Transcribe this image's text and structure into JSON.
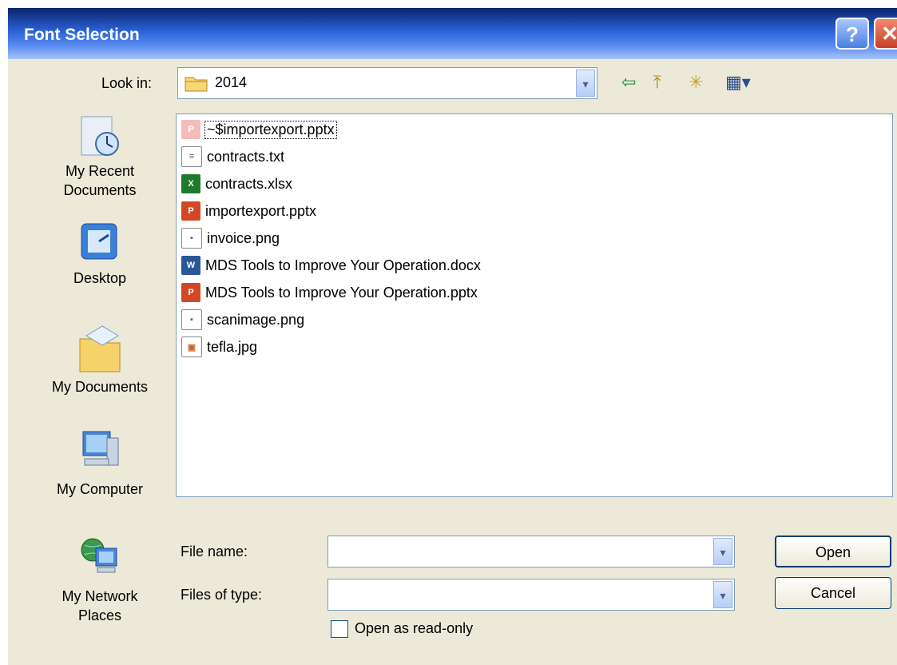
{
  "window": {
    "title": "Font Selection",
    "help_label": "?",
    "close_label": "✕"
  },
  "look_in": {
    "label": "Look in:",
    "value": "2014"
  },
  "toolbar": {
    "back_icon": "⇦",
    "up_icon": "⤒",
    "new_folder_icon": "✳",
    "views_icon": "▦▾"
  },
  "places": [
    {
      "label_line1": "My Recent",
      "label_line2": "Documents",
      "icon": "clock"
    },
    {
      "label_line1": "Desktop",
      "label_line2": "",
      "icon": "desktop"
    },
    {
      "label_line1": "My Documents",
      "label_line2": "",
      "icon": "folder"
    },
    {
      "label_line1": "My Computer",
      "label_line2": "",
      "icon": "computer"
    },
    {
      "label_line1": "My Network",
      "label_line2": "Places",
      "icon": "globe"
    }
  ],
  "files": [
    {
      "name": "~$importexport.pptx",
      "type": "pptx-temp",
      "color": "#f2a0a0",
      "glyph": "P"
    },
    {
      "name": "contracts.txt",
      "type": "txt",
      "color": "#ffffff",
      "glyph": "≡"
    },
    {
      "name": "contracts.xlsx",
      "type": "xlsx",
      "color": "#1e7a2e",
      "glyph": "X"
    },
    {
      "name": "importexport.pptx",
      "type": "pptx",
      "color": "#d24726",
      "glyph": "P"
    },
    {
      "name": "invoice.png",
      "type": "png",
      "color": "#3a73c8",
      "glyph": "▪"
    },
    {
      "name": "MDS Tools to Improve Your Operation.docx",
      "type": "docx",
      "color": "#2b579a",
      "glyph": "W"
    },
    {
      "name": "MDS Tools to Improve Your Operation.pptx",
      "type": "pptx",
      "color": "#d24726",
      "glyph": "P"
    },
    {
      "name": "scanimage.png",
      "type": "png",
      "color": "#3a73c8",
      "glyph": "▪"
    },
    {
      "name": "tefla.jpg",
      "type": "jpg",
      "color": "#c8682a",
      "glyph": "▣"
    }
  ],
  "form": {
    "file_name_label": "File name:",
    "file_name_value": "",
    "files_of_type_label": "Files of type:",
    "files_of_type_value": "",
    "read_only_label": "Open as read-only",
    "read_only_checked": false
  },
  "buttons": {
    "open": "Open",
    "cancel": "Cancel"
  }
}
